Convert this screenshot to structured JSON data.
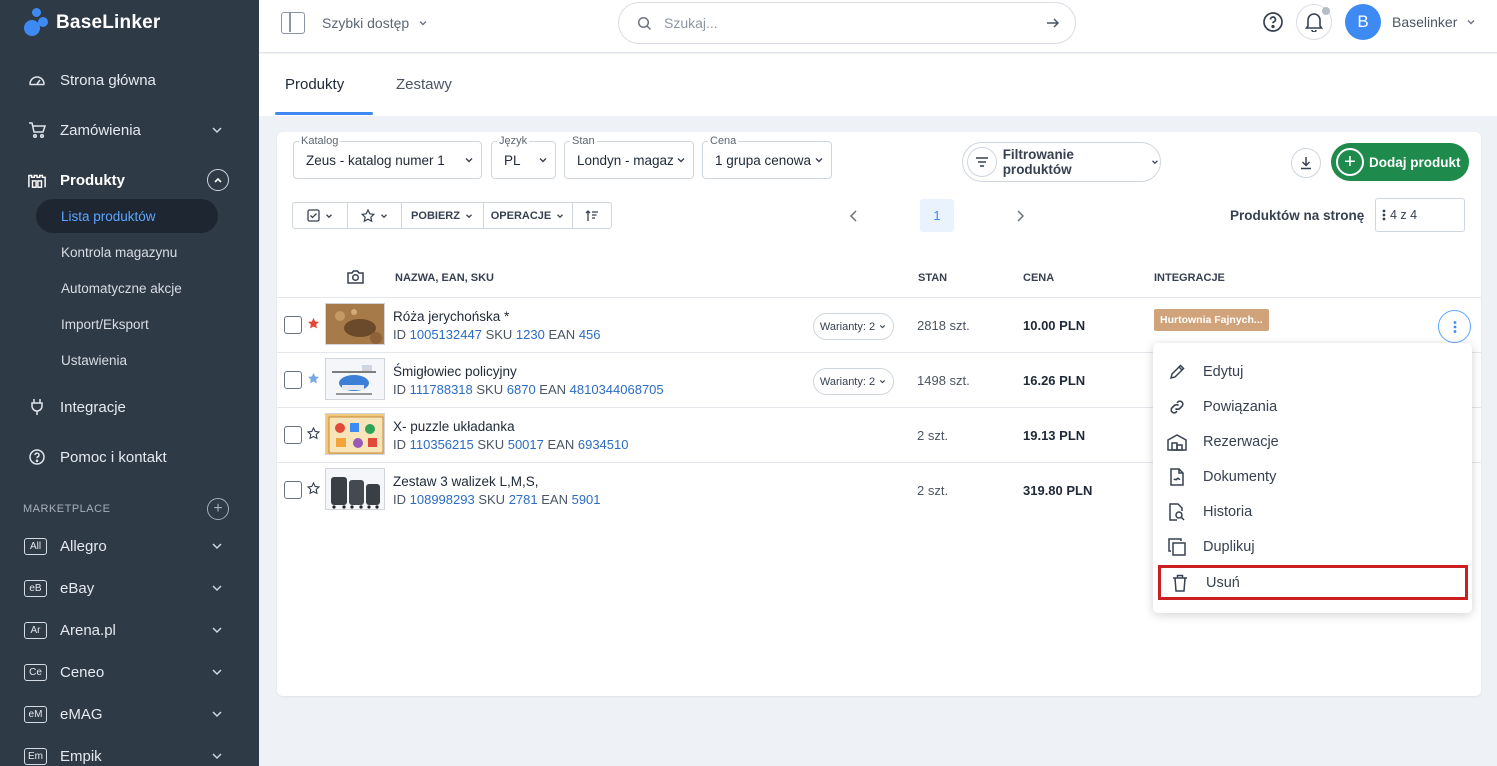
{
  "brand": {
    "name": "BaseLinker"
  },
  "sidebar": {
    "items": [
      {
        "label": "Strona główna"
      },
      {
        "label": "Zamówienia"
      },
      {
        "label": "Produkty"
      },
      {
        "label": "Integracje"
      },
      {
        "label": "Pomoc i kontakt"
      }
    ],
    "products_sub": [
      {
        "label": "Lista produktów"
      },
      {
        "label": "Kontrola magazynu"
      },
      {
        "label": "Automatyczne akcje"
      },
      {
        "label": "Import/Eksport"
      },
      {
        "label": "Ustawienia"
      }
    ],
    "marketplace_label": "MARKETPLACE",
    "marketplaces": [
      {
        "badge": "All",
        "label": "Allegro"
      },
      {
        "badge": "eB",
        "label": "eBay"
      },
      {
        "badge": "Ar",
        "label": "Arena.pl"
      },
      {
        "badge": "Ce",
        "label": "Ceneo"
      },
      {
        "badge": "eM",
        "label": "eMAG"
      },
      {
        "badge": "Em",
        "label": "Empik"
      }
    ]
  },
  "topbar": {
    "quick_access": "Szybki dostęp",
    "search_placeholder": "Szukaj...",
    "avatar_letter": "B",
    "username": "Baselinker"
  },
  "tabs": [
    {
      "label": "Produkty"
    },
    {
      "label": "Zestawy"
    }
  ],
  "filters": {
    "catalog": {
      "label": "Katalog",
      "value": "Zeus - katalog numer 1"
    },
    "language": {
      "label": "Język",
      "value": "PL"
    },
    "stock": {
      "label": "Stan",
      "value": "Londyn - magaz"
    },
    "price": {
      "label": "Cena",
      "value": "1 grupa cenowa"
    },
    "filter_button": "Filtrowanie produktów",
    "add_button": "Dodaj produkt"
  },
  "toolbar": {
    "fetch": "POBIERZ",
    "operations": "OPERACJE"
  },
  "pagination": {
    "current": "1",
    "per_page_label": "Produktów na stronę",
    "per_page_value": "4 z 4"
  },
  "table": {
    "headers": {
      "name": "NAZWA, EAN, SKU",
      "stock": "STAN",
      "price": "CENA",
      "integrations": "INTEGRACJE"
    },
    "rows": [
      {
        "name": "Róża jerychońska *",
        "id_label": "ID",
        "id": "1005132447",
        "sku_label": "SKU",
        "sku": "1230",
        "ean_label": "EAN",
        "ean": "456",
        "variants": "Warianty: 2",
        "stock": "2818 szt.",
        "price": "10.00 PLN",
        "integration": "Hurtownia Fajnych...",
        "star": "red"
      },
      {
        "name": "Śmigłowiec policyjny",
        "id_label": "ID",
        "id": "111788318",
        "sku_label": "SKU",
        "sku": "6870",
        "ean_label": "EAN",
        "ean": "4810344068705",
        "variants": "Warianty: 2",
        "stock": "1498 szt.",
        "price": "16.26 PLN",
        "star": "blue"
      },
      {
        "name": "X- puzzle układanka",
        "id_label": "ID",
        "id": "110356215",
        "sku_label": "SKU",
        "sku": "50017",
        "ean_label": "EAN",
        "ean": "6934510",
        "stock": "2 szt.",
        "price": "19.13 PLN",
        "star": "empty"
      },
      {
        "name": "Zestaw 3 walizek L,M,S,",
        "id_label": "ID",
        "id": "108998293",
        "sku_label": "SKU",
        "sku": "2781",
        "ean_label": "EAN",
        "ean": "5901",
        "stock": "2 szt.",
        "price": "319.80 PLN",
        "star": "empty"
      }
    ]
  },
  "context_menu": {
    "items": [
      {
        "label": "Edytuj",
        "icon": "pencil-icon"
      },
      {
        "label": "Powiązania",
        "icon": "link-icon"
      },
      {
        "label": "Rezerwacje",
        "icon": "warehouse-icon"
      },
      {
        "label": "Dokumenty",
        "icon": "document-icon"
      },
      {
        "label": "Historia",
        "icon": "history-search-icon"
      },
      {
        "label": "Duplikuj",
        "icon": "copy-icon"
      },
      {
        "label": "Usuń",
        "icon": "trash-icon"
      }
    ]
  },
  "colors": {
    "sidebar": "#2f3a47",
    "accent": "#3d8bf2",
    "add_button": "#1e8a4c",
    "integration_badge": "#d1a37a",
    "highlight": "#cc1f1f"
  }
}
